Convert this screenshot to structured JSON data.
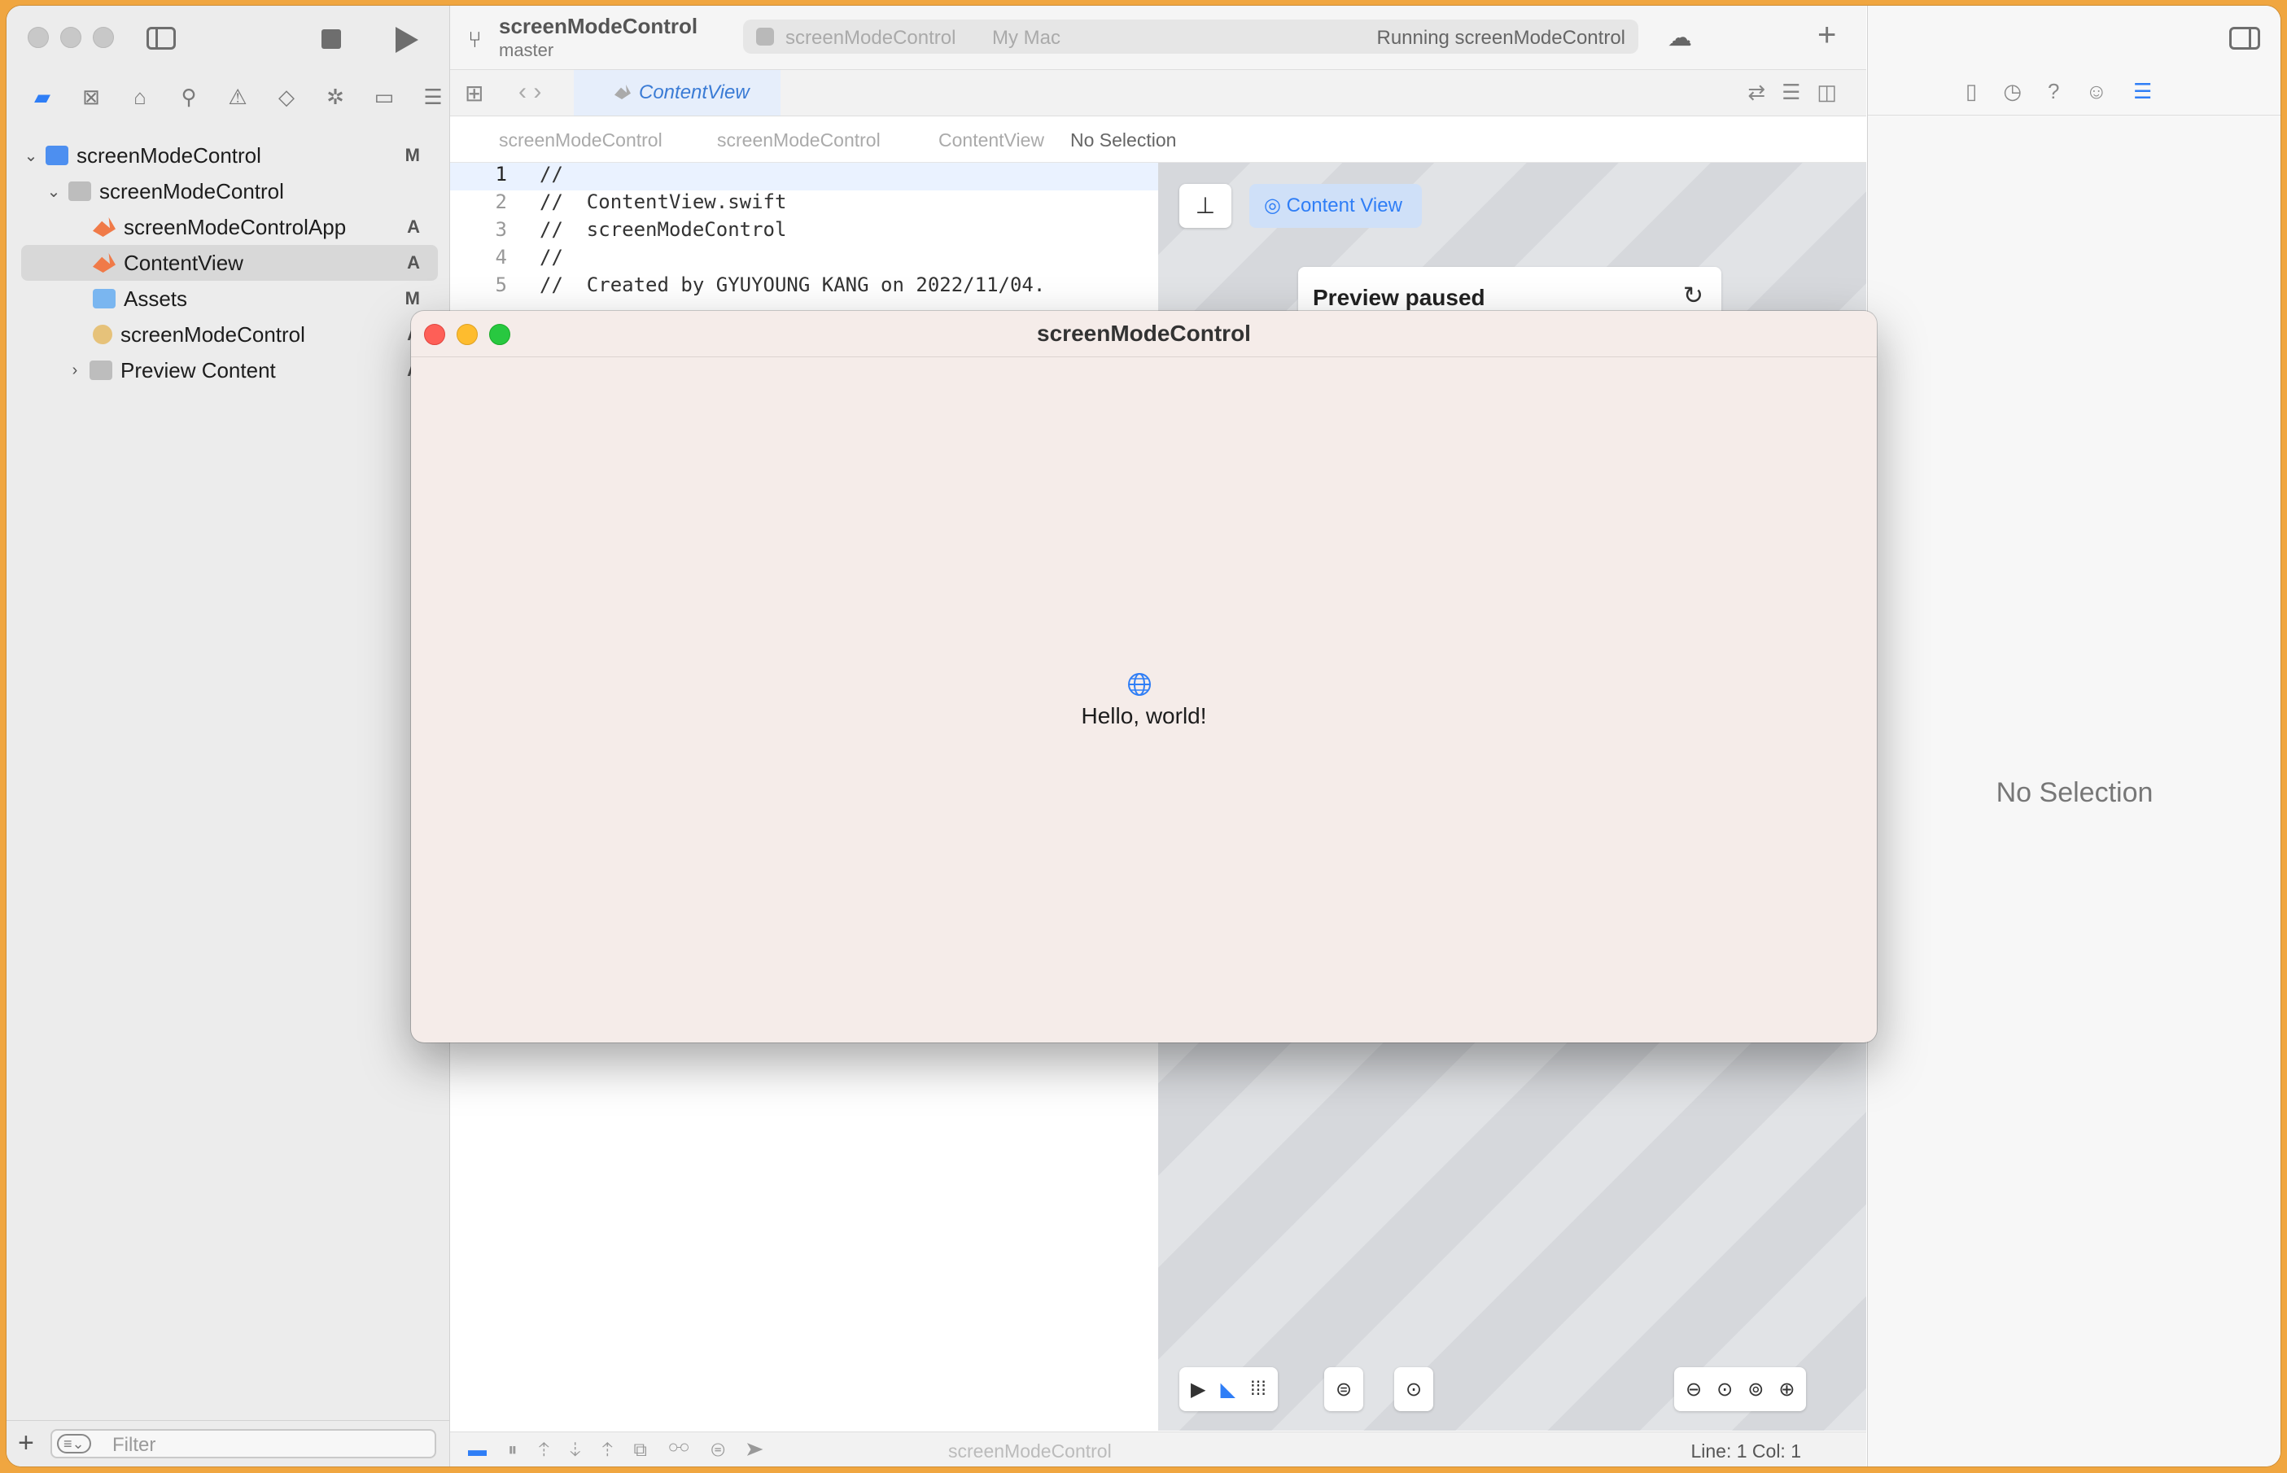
{
  "toolbar": {
    "project_name": "screenModeControl",
    "branch": "master",
    "scheme_target": "screenModeControl",
    "scheme_destination": "My Mac",
    "status": "Running screenModeControl"
  },
  "sidebar": {
    "items": [
      {
        "label": "screenModeControl",
        "badge": "M"
      },
      {
        "label": "screenModeControl",
        "badge": ""
      },
      {
        "label": "screenModeControlApp",
        "badge": "A"
      },
      {
        "label": "ContentView",
        "badge": "A"
      },
      {
        "label": "Assets",
        "badge": "M"
      },
      {
        "label": "screenModeControl",
        "badge": "A"
      },
      {
        "label": "Preview Content",
        "badge": "A"
      }
    ],
    "filter_placeholder": "Filter"
  },
  "editor": {
    "tab_label": "ContentView",
    "jumpbar": [
      "screenModeControl",
      "screenModeControl",
      "ContentView",
      "No Selection"
    ],
    "lines": [
      {
        "n": "1",
        "text": "//"
      },
      {
        "n": "2",
        "text": "//  ContentView.swift"
      },
      {
        "n": "3",
        "text": "//  screenModeControl"
      },
      {
        "n": "4",
        "text": "//"
      },
      {
        "n": "5",
        "text": "//  Created by GYUYOUNG KANG on 2022/11/04."
      }
    ]
  },
  "canvas": {
    "content_view_label": "Content View",
    "preview_status": "Preview paused"
  },
  "statusbar": {
    "scheme": "screenModeControl",
    "position": "Line: 1  Col: 1"
  },
  "inspector": {
    "empty_text": "No Selection"
  },
  "app_window": {
    "title": "screenModeControl",
    "message": "Hello, world!"
  },
  "colors": {
    "accent": "#2f7ef6",
    "wallpaper": "#f0a640",
    "app_background": "#f5ece9"
  }
}
